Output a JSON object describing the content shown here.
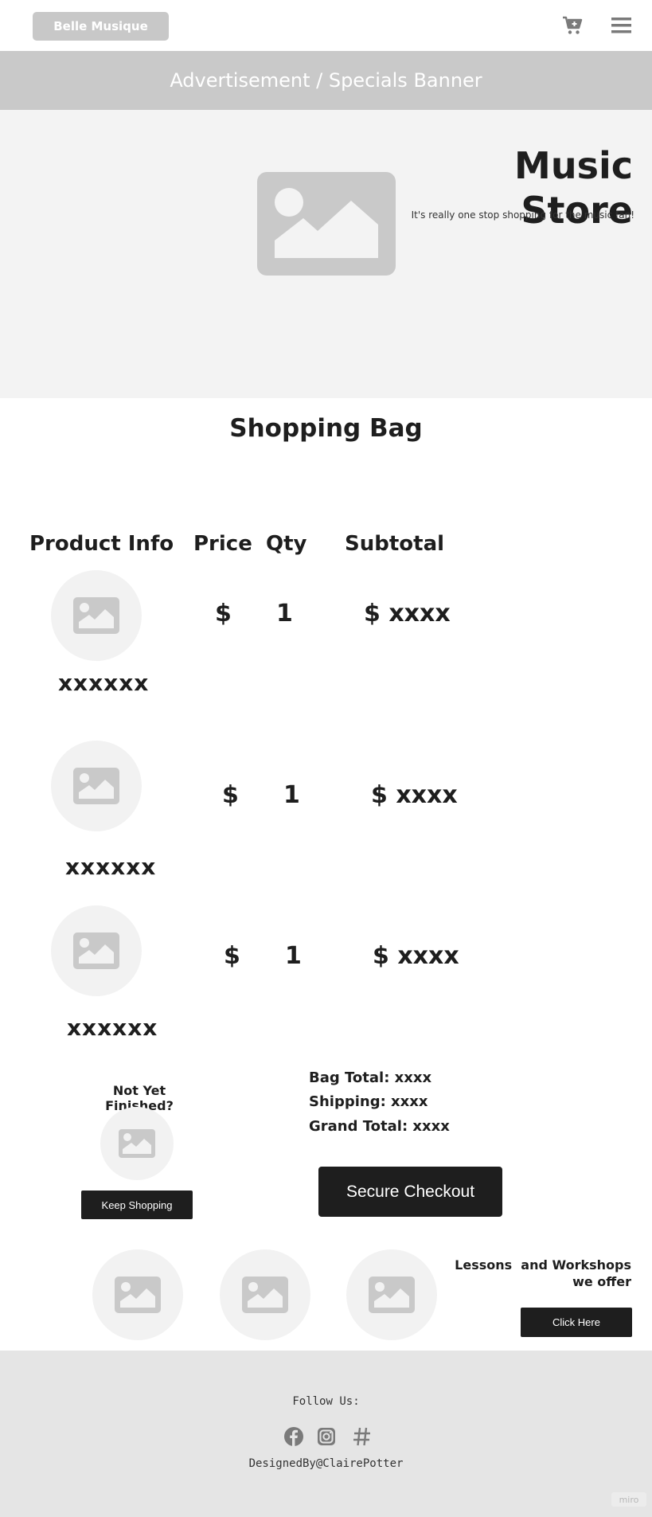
{
  "header": {
    "brand": "Belle Musique",
    "cart_icon": "cart-plus-icon",
    "menu_icon": "hamburger-menu-icon"
  },
  "banner": {
    "text": "Advertisement / Specials Banner"
  },
  "hero": {
    "title": "Music Store",
    "tagline": "It's really one stop shopping for the music fan!",
    "image_icon": "image-placeholder-icon"
  },
  "bag": {
    "title": "Shopping Bag",
    "columns": [
      "Product Info",
      "Price",
      "Qty",
      "Subtotal"
    ],
    "items": [
      {
        "name": "xxxxxx",
        "price": "$",
        "qty": "1",
        "subtotal": "$ xxxx"
      },
      {
        "name": "xxxxxx",
        "price": "$",
        "qty": "1",
        "subtotal": "$ xxxx"
      },
      {
        "name": "xxxxxx",
        "price": "$",
        "qty": "1",
        "subtotal": "$ xxxx"
      }
    ]
  },
  "continue": {
    "heading": "Not Yet Finished?",
    "button": "Keep Shopping"
  },
  "totals": {
    "bag": "Bag Total: xxxx",
    "shipping": "Shipping: xxxx",
    "grand": "Grand Total: xxxx",
    "checkout": "Secure Checkout"
  },
  "promo": {
    "text_line1": "Lessons  and Workshops",
    "text_line2": "we offer",
    "button": "Click Here"
  },
  "footer": {
    "follow": "Follow Us:",
    "credit": "DesignedBy@ClairePotter",
    "icons": [
      "facebook-icon",
      "instagram-icon",
      "hashtag-icon"
    ]
  },
  "watermark": "miro",
  "colors": {
    "dark": "#1e1e1e",
    "placeholder": "#c9c9c9",
    "hero_bg": "#f3f3f3",
    "footer_bg": "#e5e5e5"
  }
}
